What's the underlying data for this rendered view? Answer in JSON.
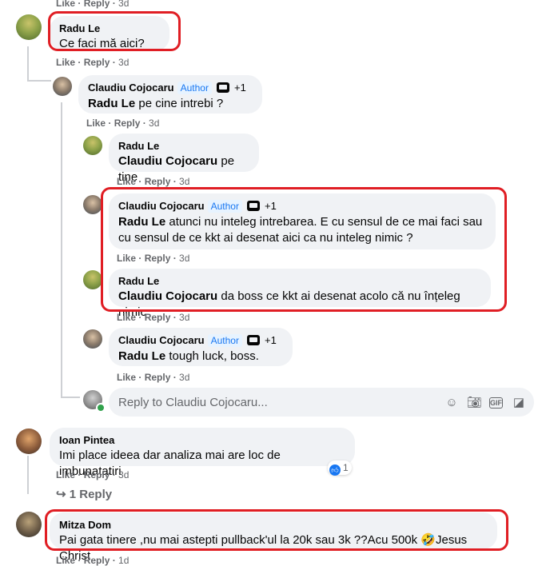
{
  "actions": {
    "like": "Like",
    "reply": "Reply",
    "time": "3d",
    "time_partial": "1d"
  },
  "author_badge": "Author",
  "mod_extra": "+1",
  "comments": {
    "top_partial": {
      "like": "Like",
      "reply": "Reply",
      "time": "3d"
    },
    "c1": {
      "author": "Radu Le",
      "text": "Ce faci mă aici?"
    },
    "c2": {
      "author": "Claudiu Cojocaru",
      "mention": "Radu Le",
      "text": " pe cine intrebi ?"
    },
    "c3": {
      "author": "Radu Le",
      "mention": "Claudiu Cojocaru",
      "text": " pe tine"
    },
    "c4": {
      "author": "Claudiu Cojocaru",
      "mention": "Radu Le",
      "text": " atunci nu inteleg intrebarea. E cu sensul de ce mai faci sau cu sensul de ce kkt ai desenat aici ca nu inteleg nimic ?"
    },
    "c5": {
      "author": "Radu Le",
      "mention": "Claudiu Cojocaru",
      "text": " da boss ce kkt ai desenat acolo că nu înțeleg nimic"
    },
    "c6": {
      "author": "Claudiu Cojocaru",
      "mention": "Radu Le",
      "text": " tough luck, boss."
    },
    "c7": {
      "author": "Ioan Pintea",
      "text": "Imi place ideea dar analiza mai are loc de imbunatatiri",
      "reaction_count": "1",
      "more_replies": "↪ 1 Reply"
    },
    "c8": {
      "author": "Mitza Dom",
      "text": "Pai gata tinere ,nu mai astepti pullback'ul la 20k sau 3k ??Acu 500k 🤣Jesus Christ"
    }
  },
  "reply_box": {
    "placeholder": "Reply to Claudiu Cojocaru..."
  },
  "icons": [
    "smile-icon",
    "camera-icon",
    "gif-icon",
    "sticker-icon",
    "moderator-icon",
    "like-reaction-icon"
  ],
  "colors": {
    "highlight_border": "#e01e24",
    "bubble_bg": "#f0f2f5",
    "meta_text": "#65676b",
    "author_badge": "#1877f2"
  }
}
